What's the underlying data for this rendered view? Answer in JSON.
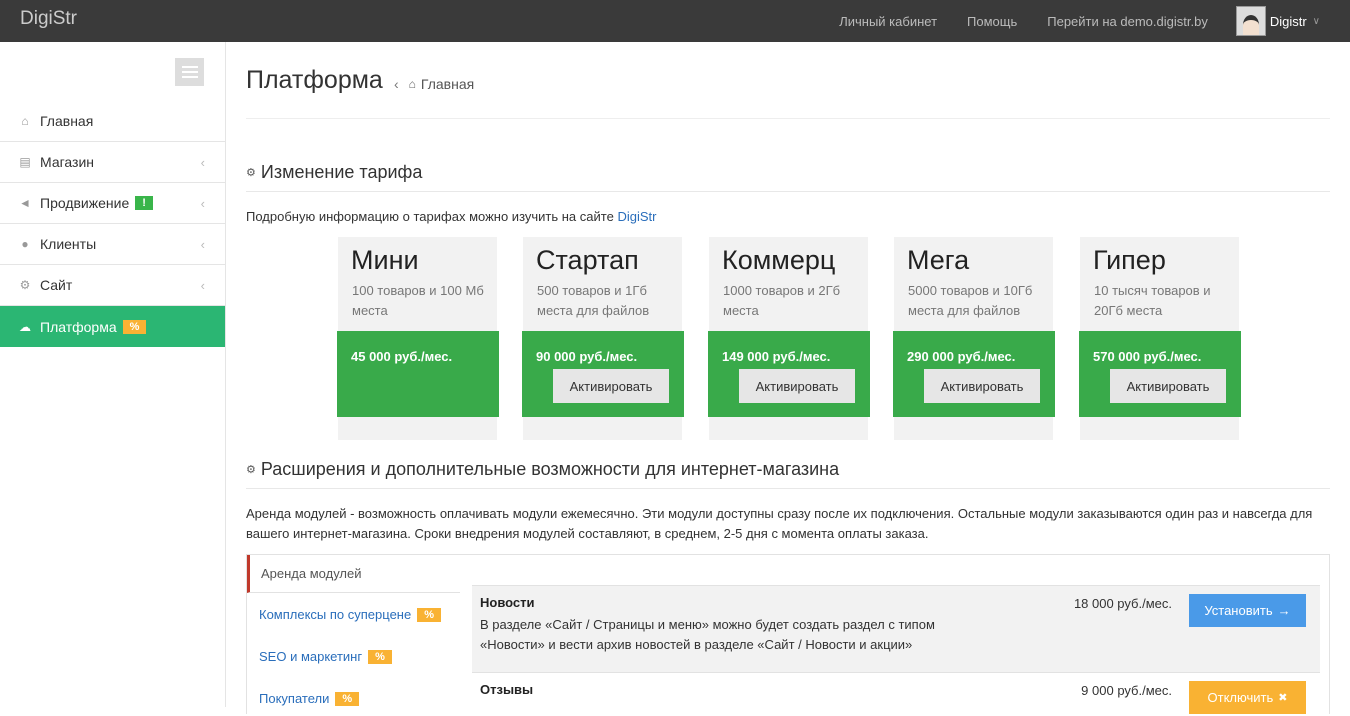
{
  "topbar": {
    "logo": "DigiStr",
    "nav": [
      "Личный кабинет",
      "Помощь",
      "Перейти на demo.digistr.by"
    ],
    "user_name": "Digistr"
  },
  "sidebar": {
    "items": [
      {
        "label": "Главная",
        "icon": "home-icon",
        "chevron": false
      },
      {
        "label": "Магазин",
        "icon": "cart-icon",
        "chevron": true
      },
      {
        "label": "Продвижение",
        "icon": "bullhorn-icon",
        "chevron": true,
        "badge": "!"
      },
      {
        "label": "Клиенты",
        "icon": "user-icon",
        "chevron": true
      },
      {
        "label": "Сайт",
        "icon": "gears-icon",
        "chevron": true
      },
      {
        "label": "Платформа",
        "icon": "cloud-icon",
        "chevron": false,
        "badge": "%",
        "active": true
      }
    ]
  },
  "header": {
    "title": "Платформа",
    "breadcrumb_sep": "‹",
    "breadcrumb_home": "Главная"
  },
  "tariffs": {
    "title": "Изменение тарифа",
    "intro": "Подробную информацию о тарифах можно изучить на сайте",
    "intro_link": "DigiStr",
    "plans": [
      {
        "name": "Мини",
        "desc": "100 товаров и 100 Мб места",
        "price": "45 000 руб./мес.",
        "action": ""
      },
      {
        "name": "Стартап",
        "desc": "500 товаров и 1Гб места для файлов",
        "price": "90 000 руб./мес.",
        "action": "Активировать"
      },
      {
        "name": "Коммерц",
        "desc": "1000 товаров и 2Гб места",
        "price": "149 000 руб./мес.",
        "action": "Активировать"
      },
      {
        "name": "Мега",
        "desc": "5000 товаров и 10Гб места для файлов",
        "price": "290 000 руб./мес.",
        "action": "Активировать"
      },
      {
        "name": "Гипер",
        "desc": "10 тысяч товаров и 20Гб места",
        "price": "570 000 руб./мес.",
        "action": "Активировать"
      }
    ]
  },
  "extensions": {
    "title": "Расширения и дополнительные возможности для интернет-магазина",
    "text": "Аренда модулей - возможность оплачивать модули ежемесячно. Эти модули доступны сразу после их подключения. Остальные модули заказываются один раз и навсегда для вашего интернет-магазина. Сроки внедрения модулей составляют, в среднем, 2-5 дня с момента оплаты заказа.",
    "active_tab": "Аренда модулей",
    "tabs": [
      {
        "label": "Комплексы по суперцене",
        "badge": "%"
      },
      {
        "label": "SEO и маркетинг",
        "badge": "%"
      },
      {
        "label": "Покупатели",
        "badge": "%"
      }
    ],
    "modules": [
      {
        "title": "Новости",
        "desc": "В разделе «Сайт / Страницы и меню» можно будет создать раздел с типом «Новости» и вести архив новостей в разделе «Сайт / Новости и акции»",
        "price": "18 000 руб./мес.",
        "action": "Установить",
        "action_icon": "→"
      },
      {
        "title": "Отзывы",
        "desc": "",
        "price": "9 000 руб./мес.",
        "action": "Отключить",
        "action_icon": "✖"
      }
    ]
  }
}
